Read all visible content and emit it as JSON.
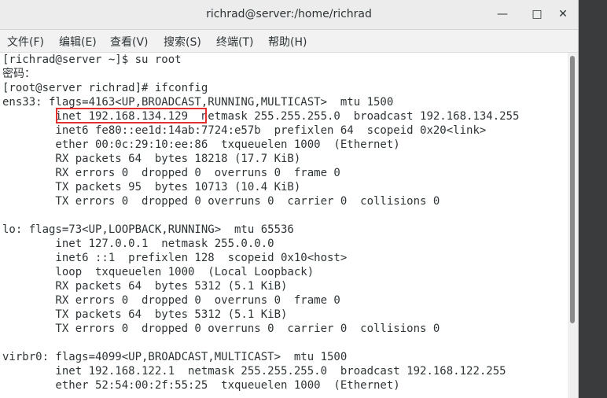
{
  "window": {
    "title": "richrad@server:/home/richrad",
    "controls": {
      "minimize": "—",
      "maximize": "□",
      "close": "✕"
    }
  },
  "menu": [
    {
      "label": "文件(F)"
    },
    {
      "label": "编辑(E)"
    },
    {
      "label": "查看(V)"
    },
    {
      "label": "搜索(S)"
    },
    {
      "label": "终端(T)"
    },
    {
      "label": "帮助(H)"
    }
  ],
  "terminal": {
    "lines": [
      "[richrad@server ~]$ su root",
      "密码：",
      "[root@server richrad]# ifconfig",
      "ens33: flags=4163<UP,BROADCAST,RUNNING,MULTICAST>  mtu 1500",
      "        inet 192.168.134.129  netmask 255.255.255.0  broadcast 192.168.134.255",
      "        inet6 fe80::ee1d:14ab:7724:e57b  prefixlen 64  scopeid 0x20<link>",
      "        ether 00:0c:29:10:ee:86  txqueuelen 1000  (Ethernet)",
      "        RX packets 64  bytes 18218 (17.7 KiB)",
      "        RX errors 0  dropped 0  overruns 0  frame 0",
      "        TX packets 95  bytes 10713 (10.4 KiB)",
      "        TX errors 0  dropped 0 overruns 0  carrier 0  collisions 0",
      "",
      "lo: flags=73<UP,LOOPBACK,RUNNING>  mtu 65536",
      "        inet 127.0.0.1  netmask 255.0.0.0",
      "        inet6 ::1  prefixlen 128  scopeid 0x10<host>",
      "        loop  txqueuelen 1000  (Local Loopback)",
      "        RX packets 64  bytes 5312 (5.1 KiB)",
      "        RX errors 0  dropped 0  overruns 0  frame 0",
      "        TX packets 64  bytes 5312 (5.1 KiB)",
      "        TX errors 0  dropped 0 overruns 0  carrier 0  collisions 0",
      "",
      "virbr0: flags=4099<UP,BROADCAST,MULTICAST>  mtu 1500",
      "        inet 192.168.122.1  netmask 255.255.255.0  broadcast 192.168.122.255",
      "        ether 52:54:00:2f:55:25  txqueuelen 1000  (Ethernet)"
    ],
    "highlight_color": "#e53030"
  }
}
